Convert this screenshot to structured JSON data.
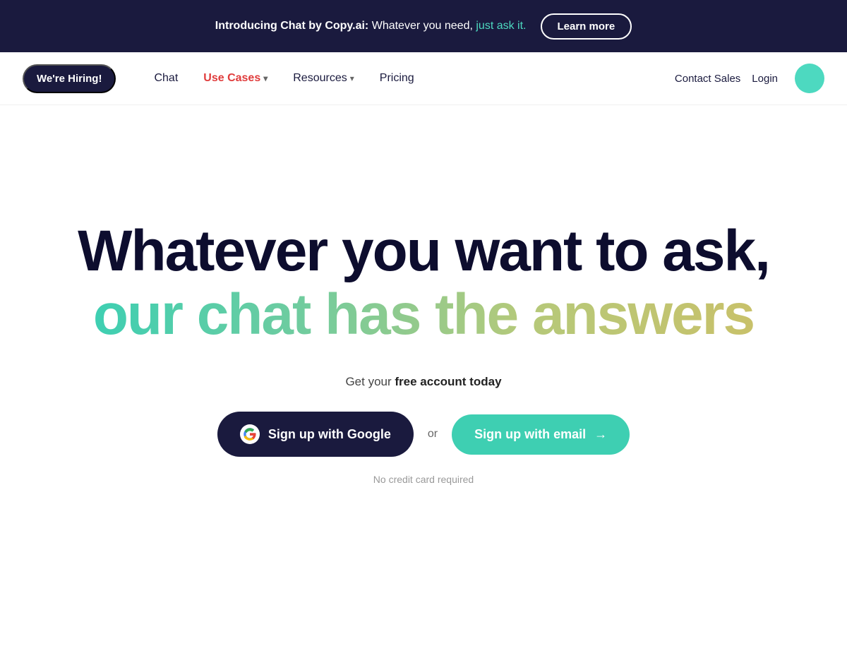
{
  "banner": {
    "text_intro": "Introducing Chat by Copy.ai:",
    "text_mid": " Whatever you need, ",
    "text_teal": "just ask it.",
    "learn_more": "Learn more"
  },
  "navbar": {
    "hiring_badge": "We're Hiring!",
    "links": [
      {
        "label": "Chat",
        "has_dropdown": false,
        "color": "normal"
      },
      {
        "label": "Use Cases",
        "has_dropdown": true,
        "color": "red"
      },
      {
        "label": "Resources",
        "has_dropdown": true,
        "color": "normal"
      },
      {
        "label": "Pricing",
        "has_dropdown": false,
        "color": "normal"
      }
    ],
    "right_links": [
      {
        "label": "Contact Sales"
      },
      {
        "label": "Login"
      }
    ]
  },
  "hero": {
    "title_line1": "Whatever you want to ask,",
    "title_line2": "our chat has the answers",
    "subtitle_pre": "Get your ",
    "subtitle_bold": "free account today",
    "btn_google": "Sign up with Google",
    "or_label": "or",
    "btn_email": "Sign up with email",
    "arrow": "→",
    "no_credit": "No credit card required"
  }
}
